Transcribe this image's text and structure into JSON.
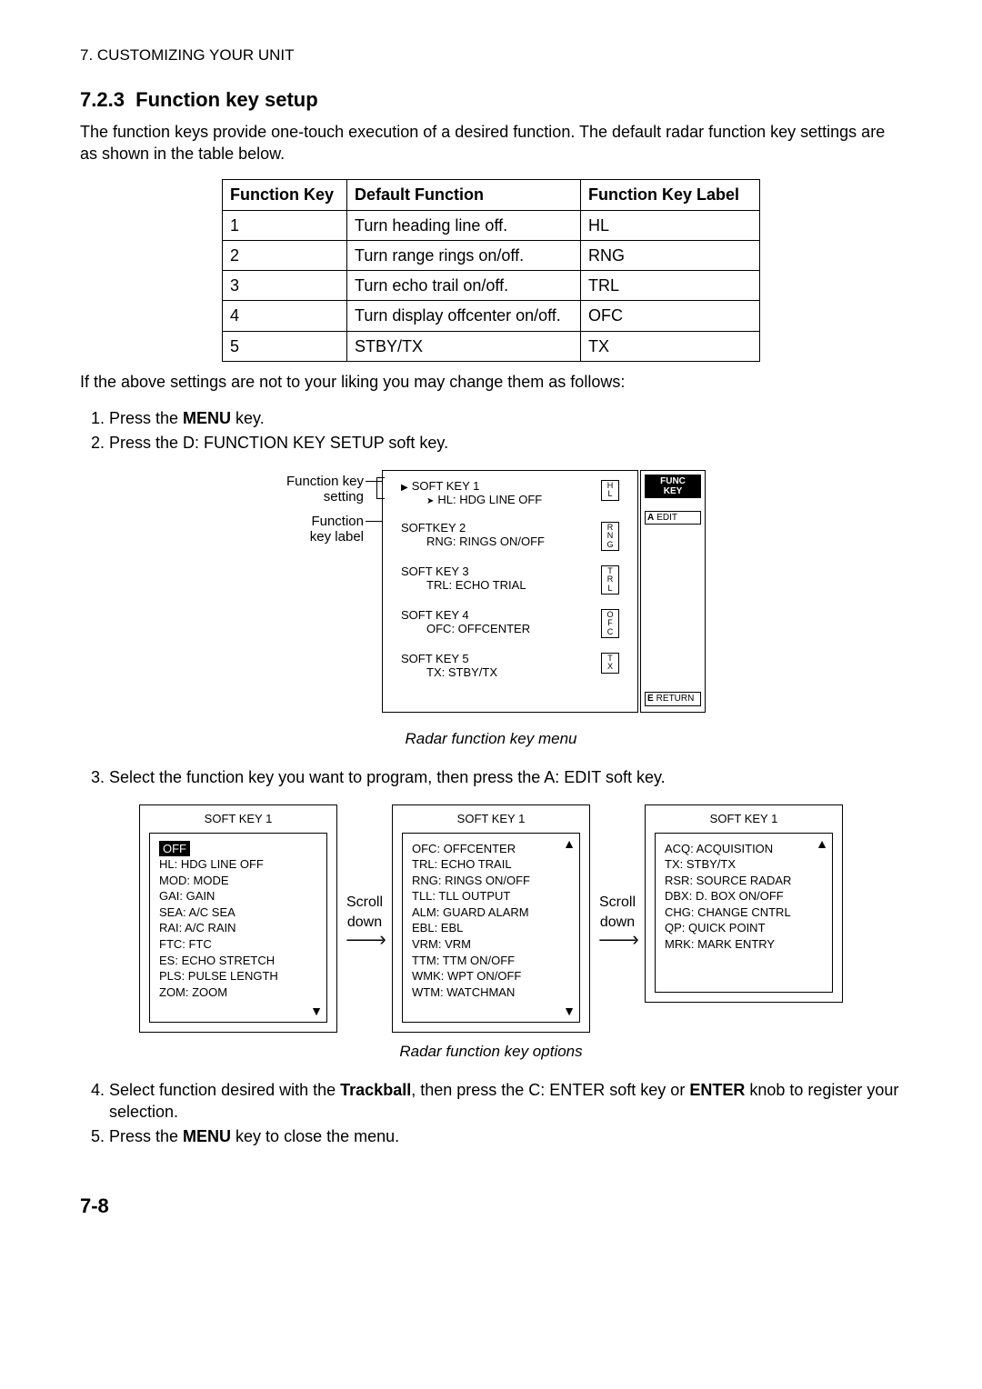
{
  "chapter_header": "7. CUSTOMIZING YOUR UNIT",
  "section_number": "7.2.3",
  "section_title": "Function key setup",
  "intro": "The function keys provide one-touch execution of a desired function. The default radar function key settings are as shown in the table below.",
  "table": {
    "headers": {
      "key": "Function Key",
      "def": "Default Function",
      "label": "Function Key Label"
    },
    "rows": [
      {
        "key": "1",
        "def": "Turn heading line off.",
        "label": "HL"
      },
      {
        "key": "2",
        "def": "Turn range rings on/off.",
        "label": "RNG"
      },
      {
        "key": "3",
        "def": "Turn echo trail on/off.",
        "label": "TRL"
      },
      {
        "key": "4",
        "def": "Turn display offcenter on/off.",
        "label": "OFC"
      },
      {
        "key": "5",
        "def": "STBY/TX",
        "label": "TX"
      }
    ]
  },
  "after_table": "If the above settings are not to your liking you may change them as follows:",
  "steps_a": [
    {
      "pre": "Press the ",
      "bold": "MENU",
      "post": " key."
    },
    {
      "pre": "Press the D: FUNCTION KEY SETUP soft key.",
      "bold": "",
      "post": ""
    }
  ],
  "fig1": {
    "label_setting": "Function key\nsetting",
    "label_keylabel": "Function\nkey label",
    "rows": [
      {
        "title": "SOFT KEY 1",
        "sub": "HL: HDG LINE OFF",
        "badge": "H\nL",
        "selected": true
      },
      {
        "title": "SOFTKEY 2",
        "sub": "RNG: RINGS ON/OFF",
        "badge": "R\nN\nG"
      },
      {
        "title": "SOFT KEY 3",
        "sub": "TRL: ECHO TRIAL",
        "badge": "T\nR\nL"
      },
      {
        "title": "SOFT KEY 4",
        "sub": "OFC: OFFCENTER",
        "badge": "O\nF\nC"
      },
      {
        "title": "SOFT KEY 5",
        "sub": "TX: STBY/TX",
        "badge": "T\nX"
      }
    ],
    "side": {
      "func": "FUNC\nKEY",
      "edit_letter": "A",
      "edit_label": "EDIT",
      "return_letter": "E",
      "return_label": "RETURN"
    },
    "caption": "Radar function key menu"
  },
  "step3": "Select the function key you want to program, then press the A: EDIT soft key.",
  "fig2": {
    "title": "SOFT KEY 1",
    "scroll_label": "Scroll\ndown",
    "panels": [
      {
        "selected": "OFF",
        "opts": [
          "HL: HDG LINE OFF",
          "MOD: MODE",
          "GAI: GAIN",
          "SEA: A/C SEA",
          "RAI: A/C RAIN",
          "FTC: FTC",
          "ES: ECHO STRETCH",
          "PLS: PULSE LENGTH",
          "ZOM: ZOOM"
        ],
        "up": false,
        "down": true
      },
      {
        "opts": [
          "OFC: OFFCENTER",
          "TRL: ECHO TRAIL",
          "RNG: RINGS ON/OFF",
          "TLL: TLL OUTPUT",
          "ALM: GUARD ALARM",
          "EBL: EBL",
          "VRM: VRM",
          "TTM: TTM ON/OFF",
          "WMK: WPT ON/OFF",
          "WTM: WATCHMAN"
        ],
        "up": true,
        "down": true
      },
      {
        "opts": [
          "ACQ: ACQUISITION",
          "TX: STBY/TX",
          "RSR: SOURCE RADAR",
          "DBX: D. BOX ON/OFF",
          "CHG: CHANGE CNTRL",
          "QP: QUICK POINT",
          "MRK: MARK ENTRY"
        ],
        "up": true,
        "down": false
      }
    ],
    "caption": "Radar function key options"
  },
  "step4": {
    "pre": "Select function desired with the ",
    "b1": "Trackball",
    "mid": ", then press the C: ENTER soft key or ",
    "b2": "ENTER",
    "post": " knob to register your selection."
  },
  "step5": {
    "pre": "Press the ",
    "bold": "MENU",
    "post": " key to close the menu."
  },
  "page_number": "7-8"
}
